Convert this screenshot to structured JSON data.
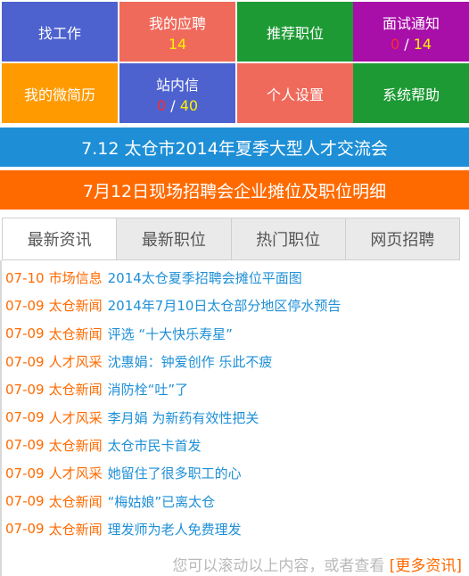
{
  "tiles": {
    "find_job": {
      "label": "找工作",
      "color": "#4d62cf"
    },
    "my_applications": {
      "label": "我的应聘",
      "count": "14",
      "color": "#f06a5c"
    },
    "recommended": {
      "label": "推荐职位",
      "color": "#1d9a34"
    },
    "interview": {
      "label": "面试通知",
      "count_a": "0",
      "slash": " / ",
      "count_b": "14",
      "color": "#a80fa8"
    },
    "resume": {
      "label": "我的微简历",
      "color": "#ff9a00"
    },
    "inbox": {
      "label": "站内信",
      "count_a": "0",
      "slash": " / ",
      "count_b": "40",
      "color": "#4d62cf"
    },
    "settings": {
      "label": "个人设置",
      "color": "#f06a5c"
    },
    "help": {
      "label": "系统帮助",
      "color": "#1d9a34"
    }
  },
  "banners": {
    "fair": {
      "text": "7.12 太仓市2014年夏季大型人才交流会",
      "color": "#1e8fd6"
    },
    "booths": {
      "text": "7月12日现场招聘会企业摊位及职位明细",
      "color": "#ff6a00"
    }
  },
  "tabs": [
    {
      "label": "最新资讯",
      "active": true
    },
    {
      "label": "最新职位",
      "active": false
    },
    {
      "label": "热门职位",
      "active": false
    },
    {
      "label": "网页招聘",
      "active": false
    }
  ],
  "news": [
    {
      "date": "07-10",
      "category": "市场信息",
      "title": "2014太仓夏季招聘会摊位平面图"
    },
    {
      "date": "07-09",
      "category": "太仓新闻",
      "title": "2014年7月10日太仓部分地区停水预告"
    },
    {
      "date": "07-09",
      "category": "太仓新闻",
      "title": "评选 “十大快乐寿星”"
    },
    {
      "date": "07-09",
      "category": "人才风采",
      "title": "沈惠娟：钟爱创作 乐此不疲"
    },
    {
      "date": "07-09",
      "category": "太仓新闻",
      "title": "消防栓“吐”了"
    },
    {
      "date": "07-09",
      "category": "人才风采",
      "title": "李月娟 为新药有效性把关"
    },
    {
      "date": "07-09",
      "category": "太仓新闻",
      "title": "太仓市民卡首发"
    },
    {
      "date": "07-09",
      "category": "人才风采",
      "title": "她留住了很多职工的心"
    },
    {
      "date": "07-09",
      "category": "太仓新闻",
      "title": "“梅姑娘”已离太仓"
    },
    {
      "date": "07-09",
      "category": "太仓新闻",
      "title": "理发师为老人免费理发"
    }
  ],
  "footer": {
    "hint": "您可以滚动以上内容，或者查看 ",
    "more": "[更多资讯]"
  }
}
